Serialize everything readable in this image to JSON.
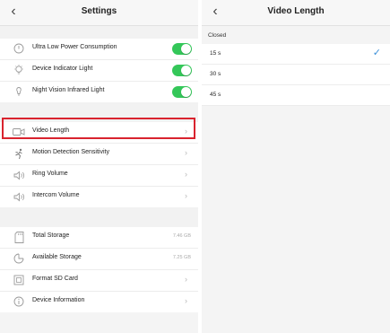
{
  "settings": {
    "title": "Settings",
    "back_icon": "chevron-left-icon",
    "power_group": [
      {
        "label": "Ultra Low Power Consumption",
        "icon": "power-icon",
        "toggle": true
      },
      {
        "label": "Device Indicator Light",
        "icon": "lightbulb-icon",
        "toggle": true
      },
      {
        "label": "Night Vision Infrared Light",
        "icon": "infrared-light-icon",
        "toggle": true
      }
    ],
    "media_group": [
      {
        "label": "Video Length",
        "icon": "video-camera-icon"
      },
      {
        "label": "Motion Detection Sensitivity",
        "icon": "running-person-icon"
      },
      {
        "label": "Ring Volume",
        "icon": "speaker-icon"
      },
      {
        "label": "Intercom Volume",
        "icon": "speaker-icon"
      }
    ],
    "storage_group": [
      {
        "label": "Total Storage",
        "icon": "sd-card-icon",
        "value": "7.46 GB"
      },
      {
        "label": "Available Storage",
        "icon": "pie-chart-icon",
        "value": "7.25 GB"
      },
      {
        "label": "Format SD Card",
        "icon": "format-icon"
      },
      {
        "label": "Device Information",
        "icon": "info-icon"
      }
    ],
    "highlight_color": "#d9232e",
    "toggle_color": "#34c759"
  },
  "video_length": {
    "title": "Video Length",
    "back_icon": "chevron-left-icon",
    "section_label": "Closed",
    "options": [
      {
        "label": "15 s",
        "selected": true
      },
      {
        "label": "30 s",
        "selected": false
      },
      {
        "label": "45 s",
        "selected": false
      }
    ],
    "check_color": "#3b8fd9"
  }
}
